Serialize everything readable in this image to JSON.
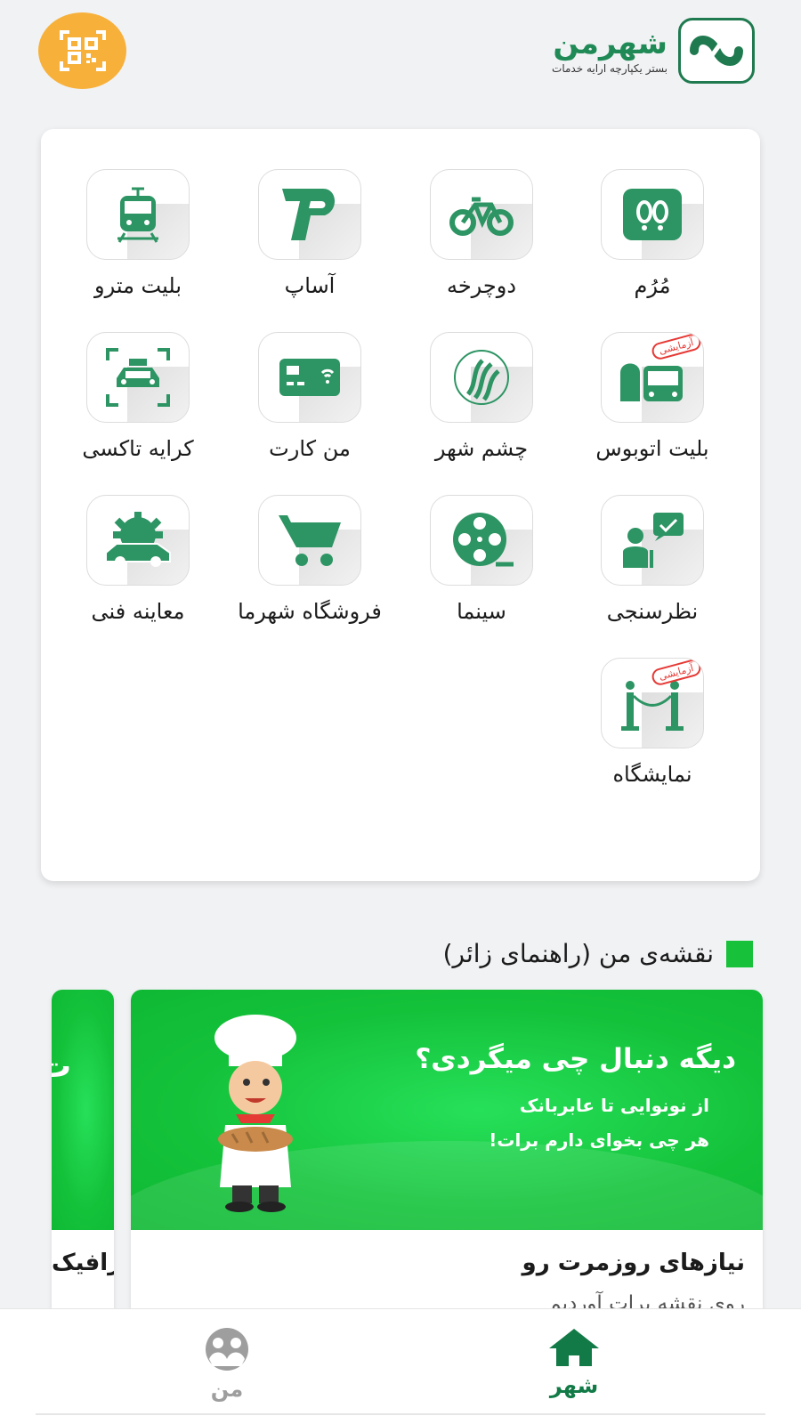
{
  "header": {
    "logo_name": "شهرمن",
    "logo_tagline": "بستر یکپارچه ارایه خدمات",
    "qr_icon": "qr-code-icon",
    "colors": {
      "accent": "#1f8a55",
      "qr_button": "#f7b13a"
    }
  },
  "services": [
    {
      "label": "مُرُم",
      "icon": "footprints-icon"
    },
    {
      "label": "دوچرخه",
      "icon": "bicycle-icon"
    },
    {
      "label": "آساپ",
      "icon": "asap-logo-icon"
    },
    {
      "label": "بلیت مترو",
      "icon": "metro-train-icon"
    },
    {
      "label": "بلیت اتوبوس",
      "icon": "bus-icon",
      "badge": "آزمایشی"
    },
    {
      "label": "چشم شهر",
      "icon": "city-eye-icon"
    },
    {
      "label": "من کارت",
      "icon": "card-icon"
    },
    {
      "label": "کرایه تاکسی",
      "icon": "taxi-icon"
    },
    {
      "label": "نظرسنجی",
      "icon": "survey-icon"
    },
    {
      "label": "سینما",
      "icon": "film-reel-icon"
    },
    {
      "label": "فروشگاه شهرما",
      "icon": "shopping-cart-icon"
    },
    {
      "label": "معاینه فنی",
      "icon": "car-inspection-icon"
    },
    {
      "label": "نمایشگاه",
      "icon": "exhibition-icon",
      "badge": "آزمایشی"
    }
  ],
  "map_section": {
    "title": "نقشه‌ی من (راهنمای زائر)",
    "cards": [
      {
        "banner_headline": "دیگه دنبال چی میگردی؟",
        "banner_line1": "از نونوایی تا عابربانک",
        "banner_line2": "هر چی بخوای دارم برات!",
        "title": "نیازهای روزمرت رو",
        "subtitle": "روی نقشه برات آوردیم"
      },
      {
        "banner_text": "ت",
        "title": "ترافیک"
      }
    ]
  },
  "bottom_nav": {
    "items": [
      {
        "label": "شهر",
        "icon": "home-icon",
        "active": true
      },
      {
        "label": "من",
        "icon": "profile-icon",
        "active": false
      }
    ]
  }
}
